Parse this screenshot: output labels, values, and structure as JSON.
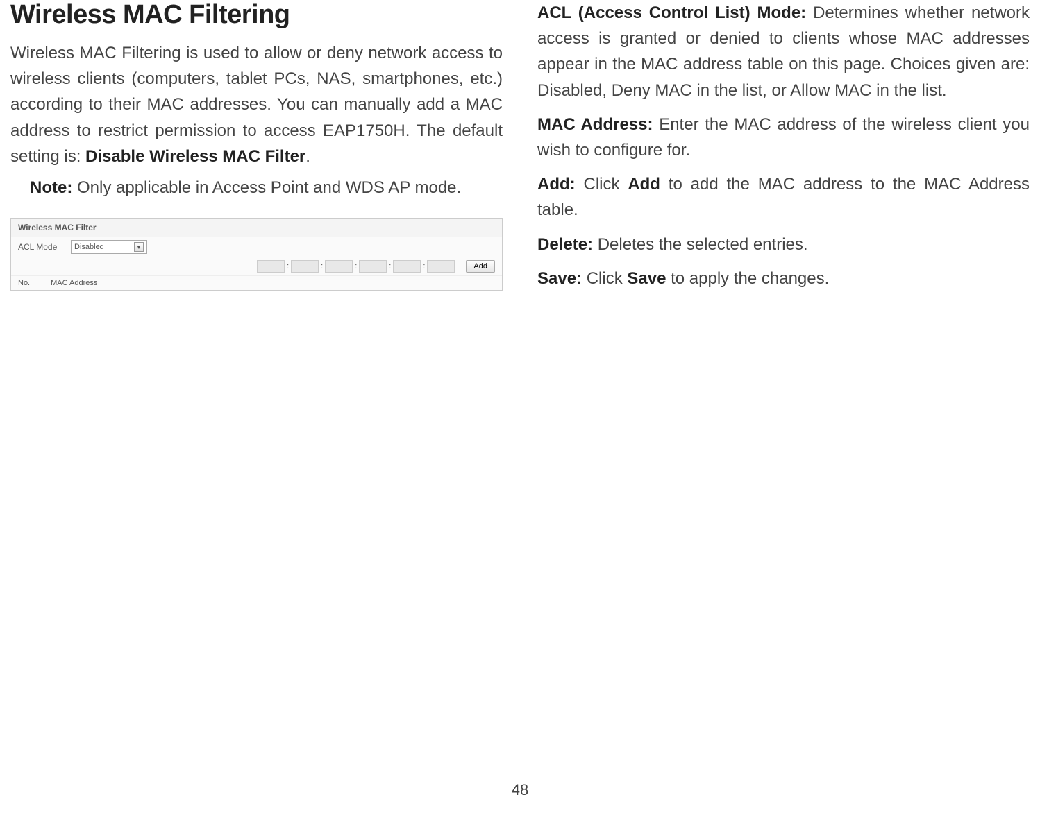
{
  "title": "Wireless MAC Filtering",
  "paragraph1_text": "Wireless MAC Filtering is used to allow or deny network access to wireless clients (computers, tablet PCs, NAS, smartphones, etc.) according to their MAC addresses. You can manually add a MAC address to restrict permission to access EAP1750H. The default setting is: ",
  "paragraph1_bold": "Disable Wireless MAC Filter",
  "note_label": "Note:",
  "note_text": " Only applicable in Access Point and WDS AP mode.",
  "screenshot": {
    "header": "Wireless MAC Filter",
    "acl_label": "ACL Mode",
    "acl_value": "Disabled",
    "add_button": "Add",
    "col_no": "No.",
    "col_mac": "MAC Address"
  },
  "defs": {
    "acl_label": "ACL (Access Control List) Mode:",
    "acl_text": " Determines whether network access is granted or denied to clients whose MAC addresses appear in the MAC address table on this page. Choices given are: Disabled, Deny MAC in the list, or Allow MAC in the list.",
    "mac_label": "MAC Address:",
    "mac_text": " Enter the MAC address of the wireless client you wish to configure for.",
    "add_label": "Add:",
    "add_text_pre": " Click ",
    "add_text_bold": "Add",
    "add_text_post": " to add the MAC address to the MAC Address table.",
    "delete_label": "Delete:",
    "delete_text": " Deletes the selected entries.",
    "save_label": "Save:",
    "save_text_pre": " Click ",
    "save_text_bold": "Save",
    "save_text_post": " to apply the changes."
  },
  "page_number": "48"
}
